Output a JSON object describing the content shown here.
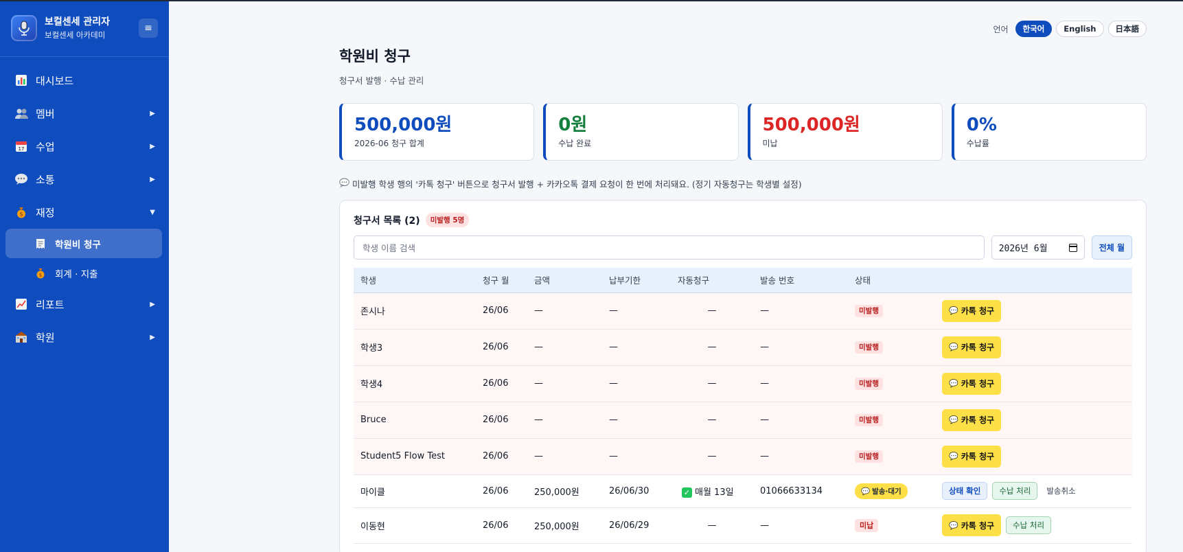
{
  "sidebar": {
    "brand_title": "보컬센세 관리자",
    "brand_sub": "보컬센세 아카데미",
    "toggle_icon": "≡",
    "items": [
      {
        "label": "대시보드",
        "icon": "chart-icon",
        "arrow": ""
      },
      {
        "label": "멤버",
        "icon": "members-icon",
        "arrow": "▶"
      },
      {
        "label": "수업",
        "icon": "calendar-icon",
        "arrow": "▶"
      },
      {
        "label": "소통",
        "icon": "speech-bubble-icon",
        "arrow": "▶"
      },
      {
        "label": "재정",
        "icon": "money-bag-icon",
        "arrow": "▼"
      },
      {
        "label": "리포트",
        "icon": "trend-chart-icon",
        "arrow": "▶"
      },
      {
        "label": "학원",
        "icon": "school-icon",
        "arrow": "▶"
      }
    ],
    "sub_items": [
      {
        "label": "학원비 청구",
        "icon": "receipt-icon",
        "active": true
      },
      {
        "label": "회계 · 지출",
        "icon": "money-bag-icon",
        "active": false
      }
    ]
  },
  "lang": {
    "label": "언어",
    "options": [
      "한국어",
      "English",
      "日本語"
    ],
    "selected": "한국어"
  },
  "page": {
    "title": "학원비 청구",
    "subtitle": "청구서 발행 · 수납 관리"
  },
  "stats": [
    {
      "value": "500,000원",
      "label": "2026-06 청구 합계",
      "color": "#0f4cbd"
    },
    {
      "value": "0원",
      "label": "수납 완료",
      "color": "#15803d"
    },
    {
      "value": "500,000원",
      "label": "미납",
      "color": "#dc2626"
    },
    {
      "value": "0%",
      "label": "수납률",
      "color": "#0f4cbd"
    }
  ],
  "notice": "미발행 학생 행의 '카톡 청구' 버튼으로 청구서 발행 + 카카오톡 결제 요청이 한 번에 처리돼요. (정기 자동청구는 학생별 설정)",
  "invoices": {
    "title": "청구서 목록 (2)",
    "badge": "미발행 5명",
    "search_placeholder": "학생 이름 검색",
    "month_value": "2026년 6월",
    "all_month_label": "전체 월",
    "columns": [
      "학생",
      "청구 월",
      "금액",
      "납부기한",
      "자동청구",
      "발송 번호",
      "상태",
      ""
    ],
    "kakao_label": "카톡 청구",
    "check_label": "상태 확인",
    "paid_label": "수납 처리",
    "cancel_label": "발송취소",
    "rows": [
      {
        "student": "존시나",
        "month": "26/06",
        "amount": "—",
        "due": "—",
        "auto": "—",
        "phone": "—",
        "status": "미발행"
      },
      {
        "student": "학생3",
        "month": "26/06",
        "amount": "—",
        "due": "—",
        "auto": "—",
        "phone": "—",
        "status": "미발행"
      },
      {
        "student": "학생4",
        "month": "26/06",
        "amount": "—",
        "due": "—",
        "auto": "—",
        "phone": "—",
        "status": "미발행"
      },
      {
        "student": "Bruce",
        "month": "26/06",
        "amount": "—",
        "due": "—",
        "auto": "—",
        "phone": "—",
        "status": "미발행"
      },
      {
        "student": "Student5 Flow Test",
        "month": "26/06",
        "amount": "—",
        "due": "—",
        "auto": "—",
        "phone": "—",
        "status": "미발행"
      },
      {
        "student": "마이클",
        "month": "26/06",
        "amount": "250,000원",
        "due": "26/06/30",
        "auto": "매월 13일",
        "phone": "01066633134",
        "status": "발송·대기"
      },
      {
        "student": "이동현",
        "month": "26/06",
        "amount": "250,000원",
        "due": "26/06/29",
        "auto": "—",
        "phone": "—",
        "status": "미납"
      }
    ]
  }
}
